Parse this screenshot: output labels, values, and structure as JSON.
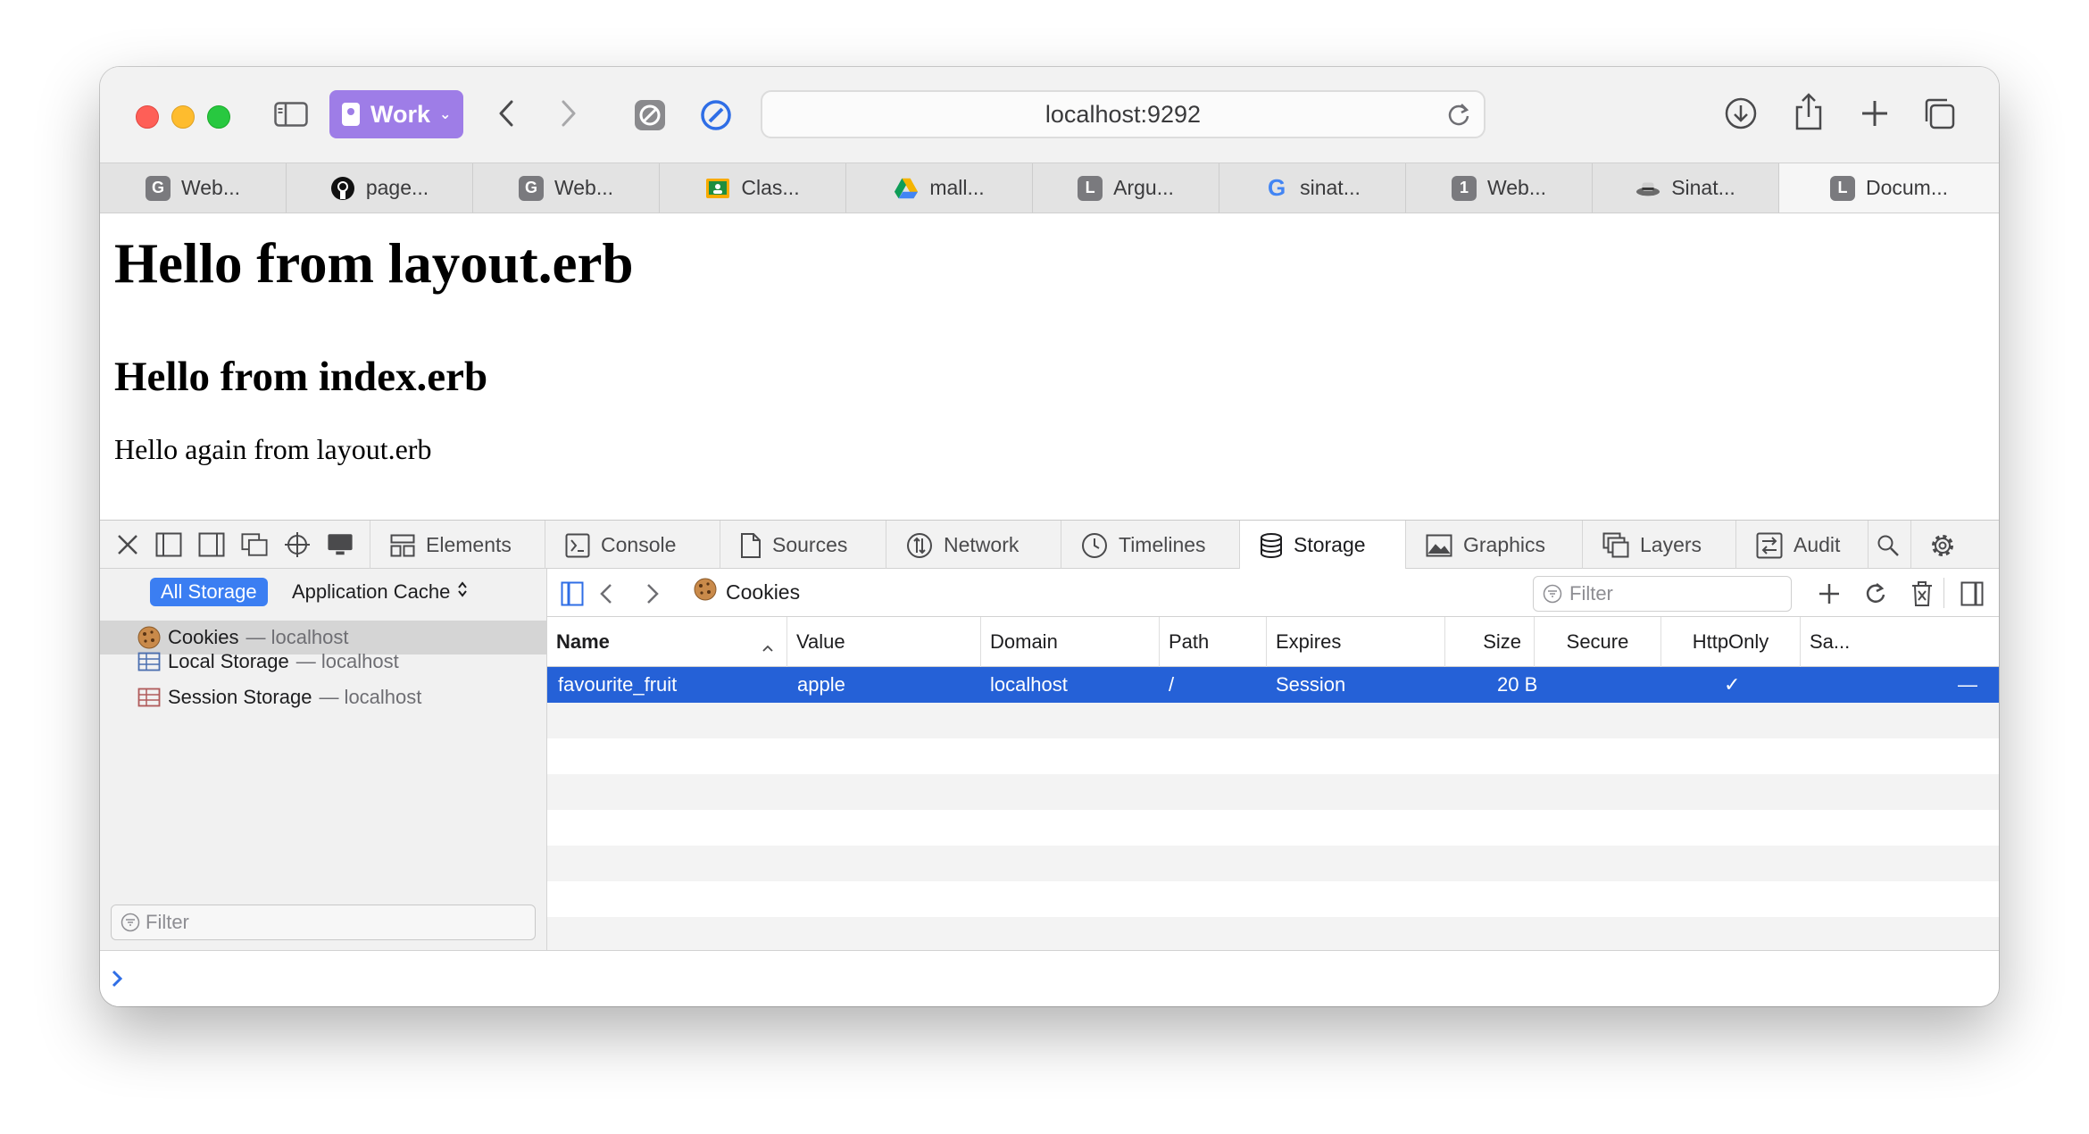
{
  "browser": {
    "profile_label": "Work",
    "url": "localhost:9292",
    "tabs": [
      {
        "icon_letter": "G",
        "icon": "letter-favicon",
        "color": "#7a7a7e",
        "label": "Web..."
      },
      {
        "icon_letter": "",
        "icon": "github-icon",
        "color": "#111111",
        "label": "page..."
      },
      {
        "icon_letter": "G",
        "icon": "letter-favicon",
        "color": "#7a7a7e",
        "label": "Web..."
      },
      {
        "icon_letter": "",
        "icon": "classroom-icon",
        "color": "#1e8e3e",
        "label": "Clas..."
      },
      {
        "icon_letter": "",
        "icon": "drive-icon",
        "color": "#f4b400",
        "label": "mall..."
      },
      {
        "icon_letter": "L",
        "icon": "letter-favicon",
        "color": "#7a7a7e",
        "label": "Argu..."
      },
      {
        "icon_letter": "G",
        "icon": "google-icon",
        "color": "#4285f4",
        "label": "sinat..."
      },
      {
        "icon_letter": "1",
        "icon": "letter-favicon",
        "color": "#7a7a7e",
        "label": "Web..."
      },
      {
        "icon_letter": "",
        "icon": "sinatra-hat-icon",
        "color": "#555555",
        "label": "Sinat..."
      },
      {
        "icon_letter": "L",
        "icon": "letter-favicon",
        "color": "#7a7a7e",
        "label": "Docum..."
      }
    ]
  },
  "page": {
    "h1": "Hello from layout.erb",
    "h2": "Hello from index.erb",
    "p": "Hello again from layout.erb"
  },
  "devtools": {
    "tabs": [
      "Elements",
      "Console",
      "Sources",
      "Network",
      "Timelines",
      "Storage",
      "Graphics",
      "Layers",
      "Audit"
    ],
    "active_tab": "Storage",
    "sidebar": {
      "all_storage": "All Storage",
      "app_cache": "Application Cache",
      "items": [
        {
          "label": "Cookies",
          "sub": "— localhost"
        },
        {
          "label": "Local Storage",
          "sub": "— localhost"
        },
        {
          "label": "Session Storage",
          "sub": "— localhost"
        }
      ],
      "filter_placeholder": "Filter"
    },
    "main": {
      "crumb": "Cookies",
      "filter_placeholder": "Filter",
      "columns": [
        "Name",
        "Value",
        "Domain",
        "Path",
        "Expires",
        "Size",
        "Secure",
        "HttpOnly",
        "Sa..."
      ],
      "rows": [
        {
          "name": "favourite_fruit",
          "value": "apple",
          "domain": "localhost",
          "path": "/",
          "expires": "Session",
          "size": "20 B",
          "secure": "",
          "httponly": "✓",
          "samesite": "—"
        }
      ]
    },
    "accent": "#2561d7"
  }
}
